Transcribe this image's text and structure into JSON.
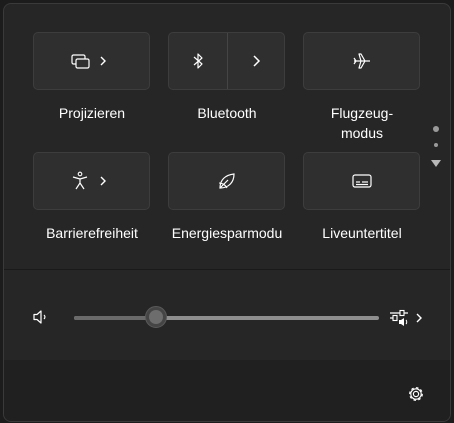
{
  "quick_settings": {
    "tiles": [
      {
        "label": "Projizieren",
        "icon": "cast-icon"
      },
      {
        "label": "Bluetooth",
        "icon": "bluetooth-icon"
      },
      {
        "label": "Flugzeug-\nmodus",
        "icon": "airplane-icon"
      },
      {
        "label": "Barrierefreiheit",
        "icon": "accessibility-icon"
      },
      {
        "label": "Energiesparmodu",
        "icon": "leaf-icon"
      },
      {
        "label": "Liveuntertitel",
        "icon": "captions-icon"
      }
    ]
  },
  "volume": {
    "level": 0.27,
    "speaker_icon": "speaker-icon",
    "output_icon": "audio-output-icon"
  },
  "footer": {
    "settings_icon": "gear-icon"
  }
}
